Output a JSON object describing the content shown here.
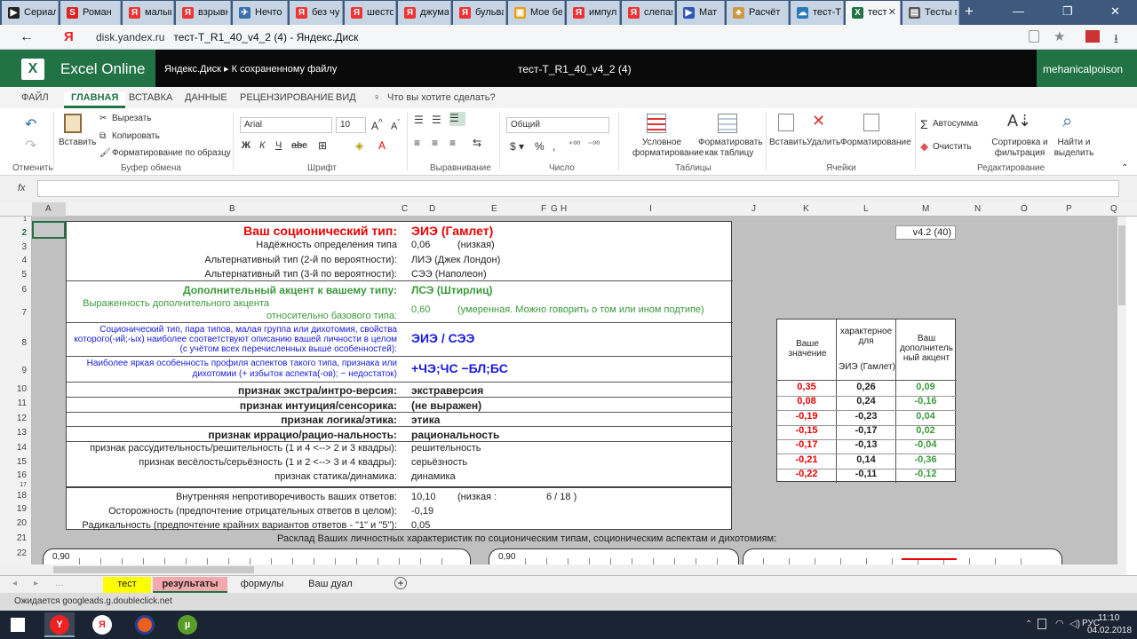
{
  "browser": {
    "tabs": [
      {
        "label": "Сериал",
        "icon": "▶",
        "color": "#222"
      },
      {
        "label": "Роман",
        "icon": "S",
        "color": "#d22"
      },
      {
        "label": "малыш",
        "icon": "Я",
        "color": "#e33"
      },
      {
        "label": "взрывн",
        "icon": "Я",
        "color": "#e33"
      },
      {
        "label": "Нечто (",
        "icon": "✈",
        "color": "#3a6fb0"
      },
      {
        "label": "без чув",
        "icon": "Я",
        "color": "#e33"
      },
      {
        "label": "шестой",
        "icon": "Я",
        "color": "#e33"
      },
      {
        "label": "джуман",
        "icon": "Я",
        "color": "#e33"
      },
      {
        "label": "бульвар",
        "icon": "Я",
        "color": "#e33"
      },
      {
        "label": "Мое бе",
        "icon": "▣",
        "color": "#e7a013"
      },
      {
        "label": "импуль",
        "icon": "Я",
        "color": "#e33"
      },
      {
        "label": "слепая",
        "icon": "Я",
        "color": "#e33"
      },
      {
        "label": "Мат",
        "icon": "▶",
        "color": "#3357b5"
      },
      {
        "label": "Расчёт",
        "icon": "♣",
        "color": "#c94"
      },
      {
        "label": "тест-Т_Р",
        "icon": "☁",
        "color": "#2a7ab8"
      },
      {
        "label": "тест-",
        "icon": "X",
        "color": "#217346",
        "active": true
      },
      {
        "label": "Тесты п",
        "icon": "▤",
        "color": "#555"
      }
    ],
    "back_label": "←",
    "yandex_label": "Я",
    "url_domain": "disk.yandex.ru",
    "url_title": "тест-Т_R1_40_v4_2 (4) - Яндекс.Диск",
    "new_tab": "+"
  },
  "excel": {
    "app_name": "Excel Online",
    "breadcrumb": "Яндекс.Диск ▸ К сохраненному файлу",
    "file_name": "тест-Т_R1_40_v4_2 (4)",
    "user": "mehanicalpoison",
    "ribbon_tabs": [
      "ФАЙЛ",
      "ГЛАВНАЯ",
      "ВСТАВКА",
      "ДАННЫЕ",
      "РЕЦЕНЗИРОВАНИЕ",
      "ВИД"
    ],
    "tell_me": "Что вы хотите сделать?",
    "clipboard": {
      "undo": "Отменить",
      "paste": "Вставить",
      "cut": "Вырезать",
      "copy": "Копировать",
      "format_painter": "Форматирование по образцу",
      "group": "Буфер обмена"
    },
    "font": {
      "name": "Arial",
      "size": "10",
      "group": "Шрифт"
    },
    "align_group": "Выравнивание",
    "number": {
      "format": "Общий",
      "group": "Число"
    },
    "tables": {
      "conditional": "Условное форматирование",
      "as_table": "Форматировать как таблицу",
      "group": "Таблицы"
    },
    "cells": {
      "insert": "Вставить",
      "delete": "Удалить",
      "format": "Форматирование",
      "group": "Ячейки"
    },
    "editing": {
      "autosum": "Автосумма",
      "clear": "Очистить",
      "sort": "Сортировка и фильтрация",
      "find": "Найти и выделить",
      "group": "Редактирование"
    },
    "fx": "fx",
    "columns": [
      "A",
      "B",
      "C",
      "D",
      "E",
      "F",
      "G",
      "H",
      "I",
      "J",
      "K",
      "L",
      "M",
      "N",
      "O",
      "P",
      "Q"
    ],
    "rows": [
      "1",
      "2",
      "3",
      "4",
      "5",
      "6",
      "7",
      "8",
      "9",
      "10",
      "11",
      "12",
      "13",
      "14",
      "15",
      "16",
      "17",
      "18",
      "19",
      "20",
      "21",
      "22"
    ]
  },
  "sheet": {
    "title_label": "Ваш соционический тип:",
    "title_value": "ЭИЭ (Гамлет)",
    "reliability_label": "Надёжность определения типа",
    "reliability_value": "0,06",
    "reliability_note": "(низкая)",
    "alt2_label": "Альтернативный тип (2-й по вероятности):",
    "alt2_value": "ЛИЭ (Джек Лондон)",
    "alt3_label": "Альтернативный тип (3-й по вероятности):",
    "alt3_value": "СЭЭ (Наполеон)",
    "accent_label": "Дополнительный акцент к вашему типу:",
    "accent_value": "ЛСЭ (Штирлиц)",
    "accent_expr_label1": "Выраженность дополнительного акцента",
    "accent_expr_label2": "относительно базового типа:",
    "accent_expr_value": "0,60",
    "accent_expr_note": "(умеренная. Можно говорить о том или ином подтипе)",
    "group_label1": "Соционический тип, пара типов, малая группа или дихотомия, свойства",
    "group_label2": "которого(-ий;-ых) наиболее соответствуют описанию вашей личности в целом",
    "group_label3": "(с учётом всех перечисленных выше особенностей):",
    "group_value": "ЭИЭ / СЭЭ",
    "feature_label1": "Наиболее яркая особенность профиля аспектов такого типа, признака или",
    "feature_label2": "дихотомии (+ избыток аспекта(-ов); − недостаток)",
    "feature_value": "+ЧЭ;ЧС −БЛ;БС",
    "version": "v4.2 (40)",
    "col_headers": {
      "yours": "Ваше значение",
      "typical1": "характерное для",
      "typical2": "ЭИЭ (Гамлет)",
      "accent": "Ваш дополнитель ный акцент"
    },
    "traits": [
      {
        "label": "признак экстра/интро-версия:",
        "value": "экстраверсия",
        "bold": true,
        "yours": "0,35",
        "typical": "0,26",
        "accent": "0,09"
      },
      {
        "label": "признак интуиция/сенсорика:",
        "value": "  (не выражен)",
        "bold": true,
        "yours": "0,08",
        "typical": "0,24",
        "accent": "-0,16"
      },
      {
        "label": "признак логика/этика:",
        "value": "этика",
        "bold": true,
        "yours": "-0,19",
        "typical": "-0,23",
        "accent": "0,04"
      },
      {
        "label": "признак иррацио/рацио-нальность:",
        "value": "рациональность",
        "bold": true,
        "yours": "-0,15",
        "typical": "-0,17",
        "accent": "0,02"
      },
      {
        "label": "признак рассудительность/решительность (1 и 4 <--> 2 и 3 квадры):",
        "value": "решительность",
        "bold": false,
        "yours": "-0,17",
        "typical": "-0,13",
        "accent": "-0,04"
      },
      {
        "label": "признак весёлость/серьёзность (1 и 2 <--> 3 и 4 квадры):",
        "value": "серьёзность",
        "bold": false,
        "yours": "-0,21",
        "typical": "0,14",
        "accent": "-0,36"
      },
      {
        "label": "признак статика/динамика:",
        "value": "динамика",
        "bold": false,
        "yours": "-0,22",
        "typical": "-0,11",
        "accent": "-0,12"
      }
    ],
    "consistency_label": "Внутренняя непротиворечивость ваших ответов:",
    "consistency_value": "10,10",
    "consistency_note": "(низкая :",
    "consistency_ratio": "6 / 18  )",
    "caution_label": "Осторожность (предпочтение отрицательных ответов в целом):",
    "caution_value": "-0,19",
    "radical_label": "Радикальность (предпочтение крайних вариантов ответов - \"1\" и \"5\"):",
    "radical_value": "0,05",
    "chart_title": "Расклад Ваших личностных характеристик по соционическим типам, соционическим аспектам и дихотомиям:",
    "chart_tick": "0,90"
  },
  "sheet_tabs": [
    "тест",
    "результаты",
    "формулы",
    "Ваш дуал"
  ],
  "status_text": "Ожидается googleads.g.doubleclick.net",
  "taskbar": {
    "lang": "РУС",
    "time": "11:10",
    "date": "04.02.2018"
  }
}
